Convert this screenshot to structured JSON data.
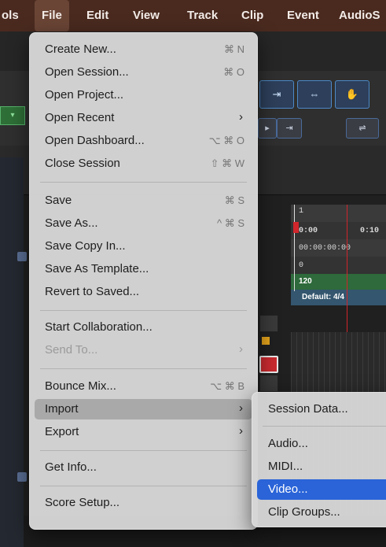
{
  "menubar": {
    "items": [
      "ols",
      "File",
      "Edit",
      "View",
      "Track",
      "Clip",
      "Event",
      "AudioS"
    ],
    "active": "File"
  },
  "file_menu": {
    "items": [
      {
        "label": "Create New...",
        "shortcut": "⌘ N"
      },
      {
        "label": "Open Session...",
        "shortcut": "⌘ O"
      },
      {
        "label": "Open Project...",
        "shortcut": ""
      },
      {
        "label": "Open Recent",
        "arrow": "›"
      },
      {
        "label": "Open Dashboard...",
        "shortcut": "⌥ ⌘ O"
      },
      {
        "label": "Close Session",
        "shortcut": "⇧ ⌘ W"
      },
      {
        "label": "Save",
        "shortcut": "⌘ S"
      },
      {
        "label": "Save As...",
        "shortcut": "^ ⌘ S"
      },
      {
        "label": "Save Copy In...",
        "shortcut": ""
      },
      {
        "label": "Save As Template...",
        "shortcut": ""
      },
      {
        "label": "Revert to Saved...",
        "shortcut": ""
      },
      {
        "label": "Start Collaboration...",
        "shortcut": ""
      },
      {
        "label": "Send To...",
        "arrow": "›",
        "disabled": true
      },
      {
        "label": "Bounce Mix...",
        "shortcut": "⌥ ⌘ B"
      },
      {
        "label": "Import",
        "arrow": "›",
        "highlighted": true
      },
      {
        "label": "Export",
        "arrow": "›"
      },
      {
        "label": "Get Info...",
        "shortcut": ""
      },
      {
        "label": "Score Setup...",
        "shortcut": ""
      }
    ]
  },
  "import_submenu": {
    "items": [
      {
        "label": "Session Data..."
      },
      {
        "label": "Audio..."
      },
      {
        "label": "MIDI..."
      },
      {
        "label": "Video...",
        "selected": true
      },
      {
        "label": "Clip Groups..."
      }
    ]
  },
  "timeline": {
    "bar": "1",
    "time_min": "0:00",
    "time_next": "0:10",
    "timecode": "00:00:00:00",
    "samples": "0",
    "tempo": "120",
    "meter": "Default: 4/4"
  },
  "colors": {
    "menubar": "#4a2a1f",
    "menu_bg": "#d6d6d6",
    "highlight": "#a9a9a9",
    "selected": "#2a64d8"
  }
}
